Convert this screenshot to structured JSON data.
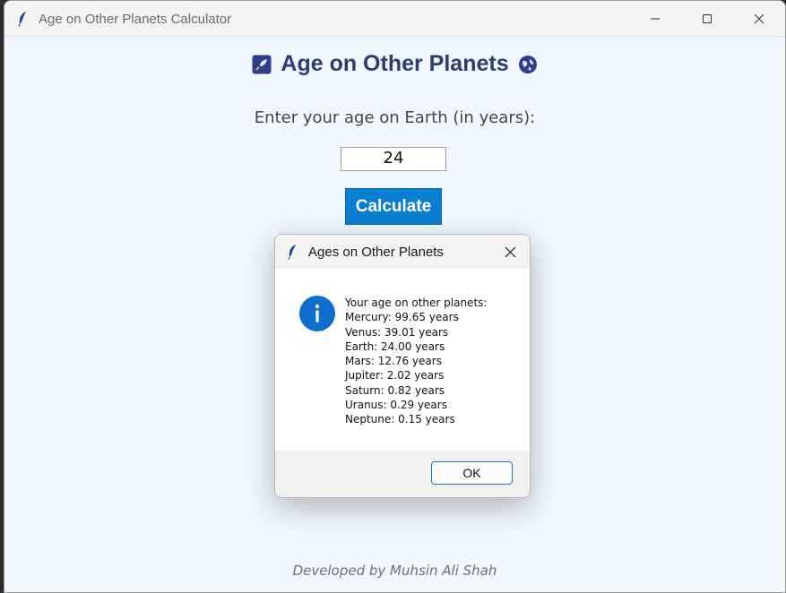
{
  "window": {
    "title": "Age on Other Planets Calculator",
    "icon": "feather-icon"
  },
  "header": {
    "title": "Age on Other Planets",
    "left_icon": "rocket-emoji-icon",
    "right_icon": "globe-emoji-icon"
  },
  "form": {
    "prompt": "Enter your age on Earth (in years):",
    "age_value": "24",
    "calculate_label": "Calculate"
  },
  "footer": {
    "credit": "Developed by Muhsin Ali Shah"
  },
  "dialog": {
    "title": "Ages on Other Planets",
    "icon": "info-icon",
    "lines": [
      "Your age on other planets:",
      "Mercury: 99.65 years",
      "Venus: 39.01 years",
      "Earth: 24.00 years",
      "Mars: 12.76 years",
      "Jupiter: 2.02 years",
      "Saturn: 0.82 years",
      "Uranus: 0.29 years",
      "Neptune: 0.15 years"
    ],
    "ok_label": "OK"
  },
  "colors": {
    "accent": "#0a7ecf",
    "heading": "#2c3d6e",
    "background": "#f0f7ff",
    "info_blue": "#0f6ecd"
  }
}
